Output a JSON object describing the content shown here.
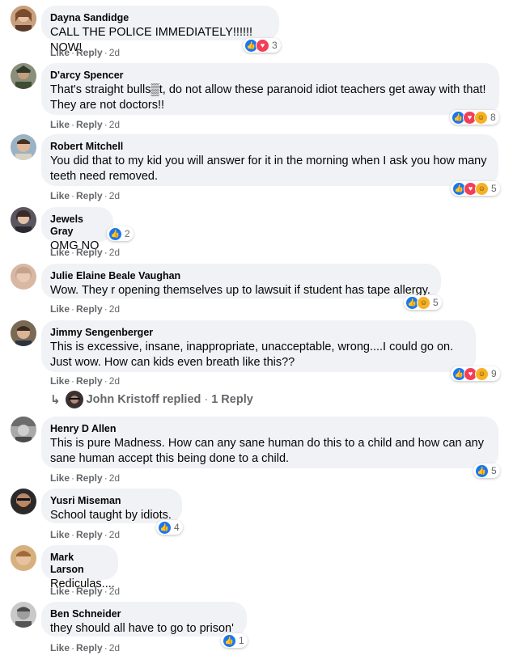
{
  "comments": [
    {
      "author": "Dayna Sandidge",
      "text": "CALL THE POLICE IMMEDIATELY!!!!!! NOW!",
      "reaction_count": "3",
      "like": "Like",
      "reply": "Reply",
      "time": "2d"
    },
    {
      "author": "D'arcy Spencer",
      "text": "That's straight bulls▒t, do not allow these paranoid idiot teachers get away with that! They are not doctors!!",
      "reaction_count": "8",
      "like": "Like",
      "reply": "Reply",
      "time": "2d"
    },
    {
      "author": "Robert Mitchell",
      "text": "You did that to my kid you will answer for it in the morning when I ask you how many teeth need removed.",
      "reaction_count": "5",
      "like": "Like",
      "reply": "Reply",
      "time": "2d"
    },
    {
      "author": "Jewels Gray",
      "text": "OMG NO",
      "reaction_count": "2",
      "like": "Like",
      "reply": "Reply",
      "time": "2d"
    },
    {
      "author": "Julie Elaine Beale Vaughan",
      "text": "Wow. They r opening themselves up to lawsuit if student has tape allergy.",
      "reaction_count": "5",
      "like": "Like",
      "reply": "Reply",
      "time": "2d"
    },
    {
      "author": "Jimmy Sengenberger",
      "text": "This is excessive, insane, inappropriate, unacceptable, wrong....I could go on. Just wow. How can kids even breath like this??",
      "reaction_count": "9",
      "like": "Like",
      "reply": "Reply",
      "time": "2d"
    },
    {
      "author": "Henry D Allen",
      "text": "This is pure Madness. How can any sane human do this to a child and how can any sane human accept this being done to a child.",
      "reaction_count": "5",
      "like": "Like",
      "reply": "Reply",
      "time": "2d"
    },
    {
      "author": "Yusri Miseman",
      "text": "School taught by idiots.",
      "reaction_count": "4",
      "like": "Like",
      "reply": "Reply",
      "time": "2d"
    },
    {
      "author": "Mark Larson",
      "text": "Rediculas....",
      "like": "Like",
      "reply": "Reply",
      "time": "2d"
    },
    {
      "author": "Ben Schneider",
      "text": "they should all have to go to prison'",
      "reaction_count": "1",
      "like": "Like",
      "reply": "Reply",
      "time": "2d"
    }
  ],
  "replies": {
    "author": "John Kristoff",
    "replied": "replied",
    "count": "1 Reply"
  },
  "colors": {
    "like": "#1877f2",
    "love": "#f33e58",
    "haha": "#f7b125",
    "bubble": "#f0f2f5",
    "meta": "#65676b"
  }
}
